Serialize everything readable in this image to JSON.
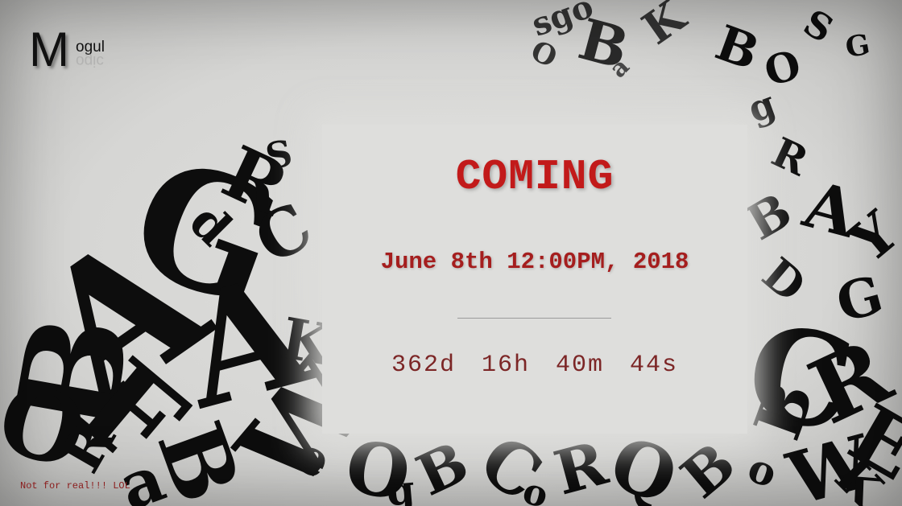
{
  "logo": {
    "initial": "M",
    "rest": "ogul",
    "reflection": "ogic"
  },
  "panel": {
    "title": "COMING",
    "date": "June 8th 12:00PM, 2018",
    "countdown": {
      "days": "362d",
      "hours": "16h",
      "minutes": "40m",
      "seconds": "44s"
    }
  },
  "footer": {
    "note": "Not for real!!! LOL"
  },
  "colors": {
    "accent_red": "#c21a1a",
    "date_red": "#a51e1e",
    "countdown_red": "#7c2626",
    "background": "#d9d9d7"
  }
}
